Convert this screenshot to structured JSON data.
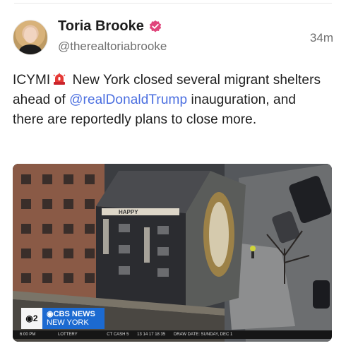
{
  "post": {
    "display_name": "Toria Brooke",
    "handle": "@therealtoriabrooke",
    "time": "34m",
    "text_before": "ICYMI",
    "text_middle": " New York closed several migrant shelters ahead of ",
    "mention": "@realDonaldTrump",
    "text_after": " inauguration, and there are reportedly plans to close more.",
    "icons": {
      "verified": "verified-badge-icon",
      "siren": "siren-icon"
    }
  },
  "media": {
    "banner_brand": "CBS NEWS",
    "banner_city": "NEW YORK",
    "channel": "2",
    "ticker": {
      "time": "6:00 PM",
      "label": "LOTTERY",
      "game": "CT CASH 5",
      "numbers": "13 14 17 18 35",
      "draw_date": "DRAW DATE: SUNDAY, DEC 1"
    },
    "building_sign": "HAPPY"
  },
  "colors": {
    "mention": "#4a6ee0",
    "verified": "#e0457b",
    "cbs_blue": "#1c6ad1"
  }
}
